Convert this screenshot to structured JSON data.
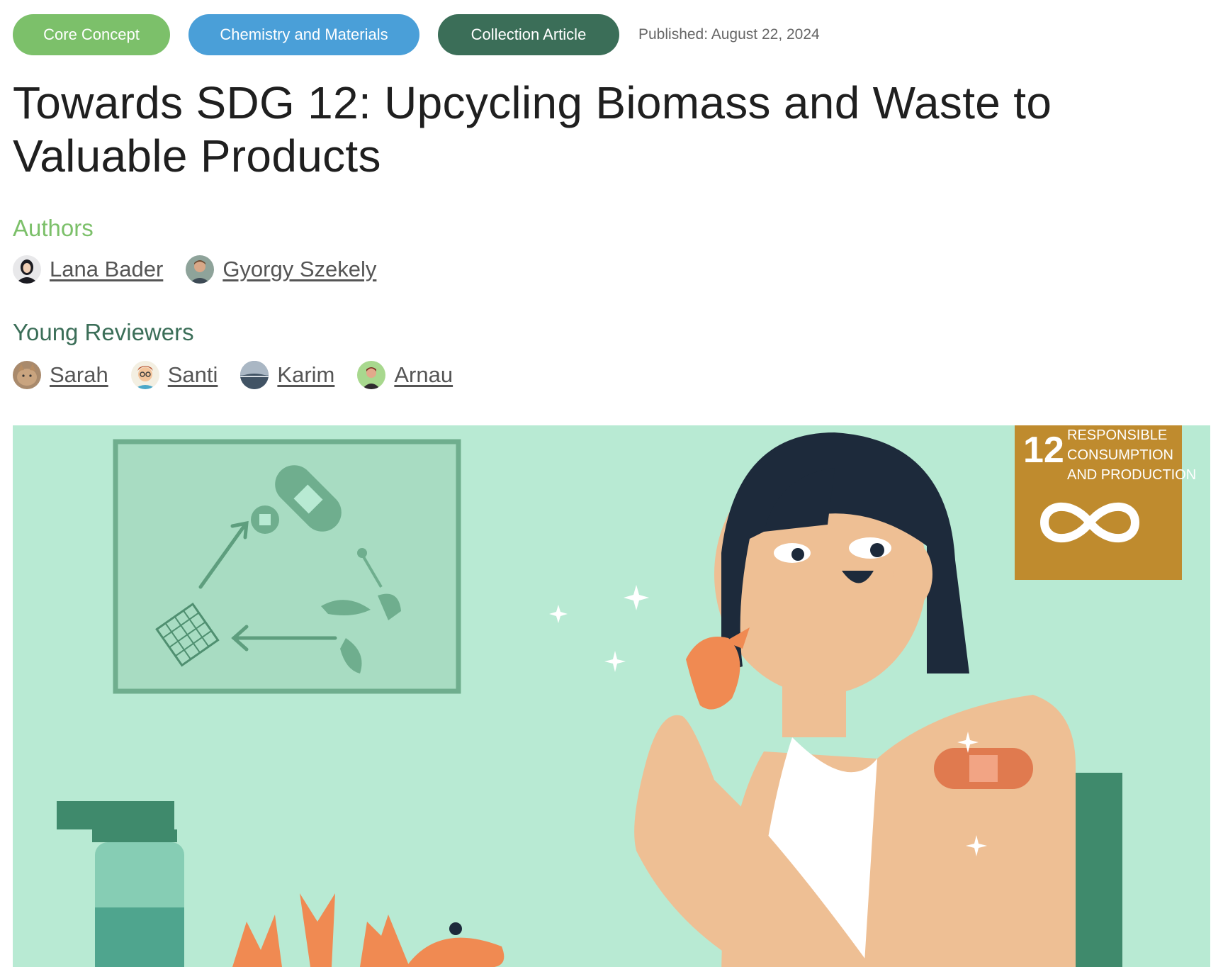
{
  "tags": {
    "core": "Core Concept",
    "chemistry": "Chemistry and Materials",
    "collection": "Collection Article"
  },
  "published": "Published: August 22, 2024",
  "title": "Towards SDG 12: Upcycling Biomass and Waste to Valuable Products",
  "authors": {
    "heading": "Authors",
    "people": [
      {
        "name": "Lana Bader"
      },
      {
        "name": "Gyorgy Szekely"
      }
    ]
  },
  "reviewers": {
    "heading": "Young Reviewers",
    "people": [
      {
        "name": "Sarah"
      },
      {
        "name": "Santi"
      },
      {
        "name": "Karim"
      },
      {
        "name": "Arnau"
      }
    ]
  },
  "hero": {
    "sdg_number": "12",
    "sdg_line1": "RESPONSIBLE",
    "sdg_line2": "CONSUMPTION",
    "sdg_line3": "AND PRODUCTION"
  },
  "colors": {
    "core_tag": "#7cc06a",
    "chemistry_tag": "#4a9fd8",
    "collection_tag": "#3b6e58",
    "hero_bg": "#b8ead3",
    "sdg_box": "#bf8b2e"
  }
}
